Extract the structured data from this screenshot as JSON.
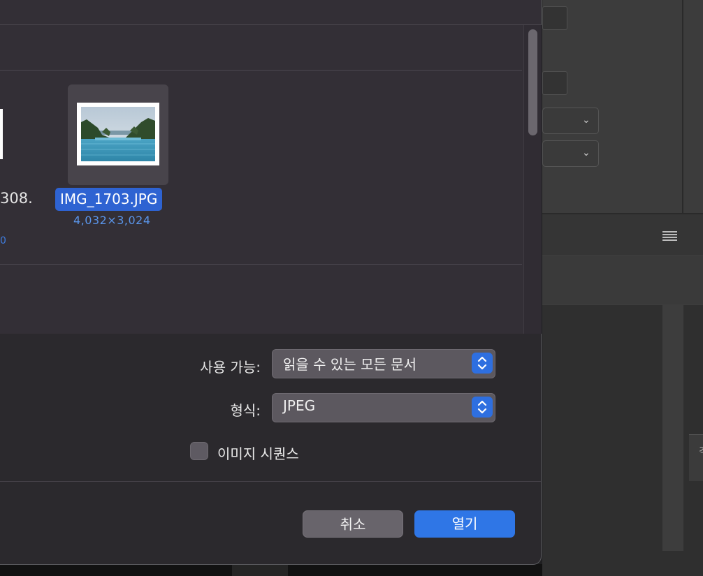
{
  "browser": {
    "previous_file": {
      "name_fragment": "308.",
      "dim_fragment": "0"
    },
    "selected_file": {
      "name": "IMG_1703.JPG",
      "dimensions": "4,032×3,024"
    }
  },
  "options": {
    "enable_label": "사용 가능:",
    "enable_value": "읽을 수 있는 모든 문서",
    "format_label": "형식:",
    "format_value": "JPEG",
    "image_sequence_label": "이미지 시퀀스",
    "image_sequence_checked": false
  },
  "buttons": {
    "cancel": "취소",
    "open": "열기"
  },
  "background_app": {
    "tab_fragment": "격"
  },
  "colors": {
    "accent": "#2f76e6",
    "selection": "#2e63d2",
    "dialog_bg": "#2b292d"
  }
}
